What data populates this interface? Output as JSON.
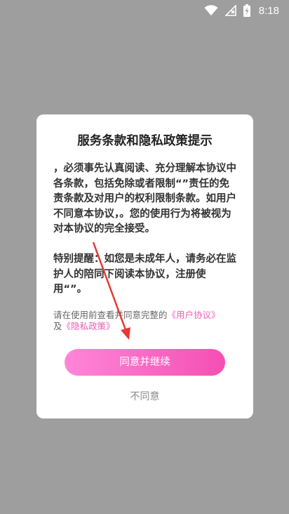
{
  "status_bar": {
    "time": "8:18"
  },
  "dialog": {
    "title": "服务条款和隐私政策提示",
    "paragraph1": "，必须事先认真阅读、充分理解本协议中各条款，包括免除或者限制“”责任的免责条款及对用户的权利限制条款。如用户不同意本协议，。您的使用行为将被视为对本协议的完全接受。",
    "paragraph2": "特别提醒：如您是未成年人，请务必在监护人的陪同下阅读本协议，注册使用“”。",
    "note_prefix": "请在使用前查看并同意完整的",
    "user_agreement_link": "《用户协议》",
    "note_and": "及",
    "privacy_policy_link": "《隐私政策》",
    "continue_label": "同意并继续",
    "disagree_label": "不同意"
  },
  "colors": {
    "overlay": "#9e9e9e",
    "accent": "#f44fb3",
    "link": "#ee5db7",
    "arrow": "#e53935"
  },
  "icons": [
    "wifi-icon",
    "signal-icon",
    "battery-charging-icon",
    "annotation-arrow-icon"
  ]
}
